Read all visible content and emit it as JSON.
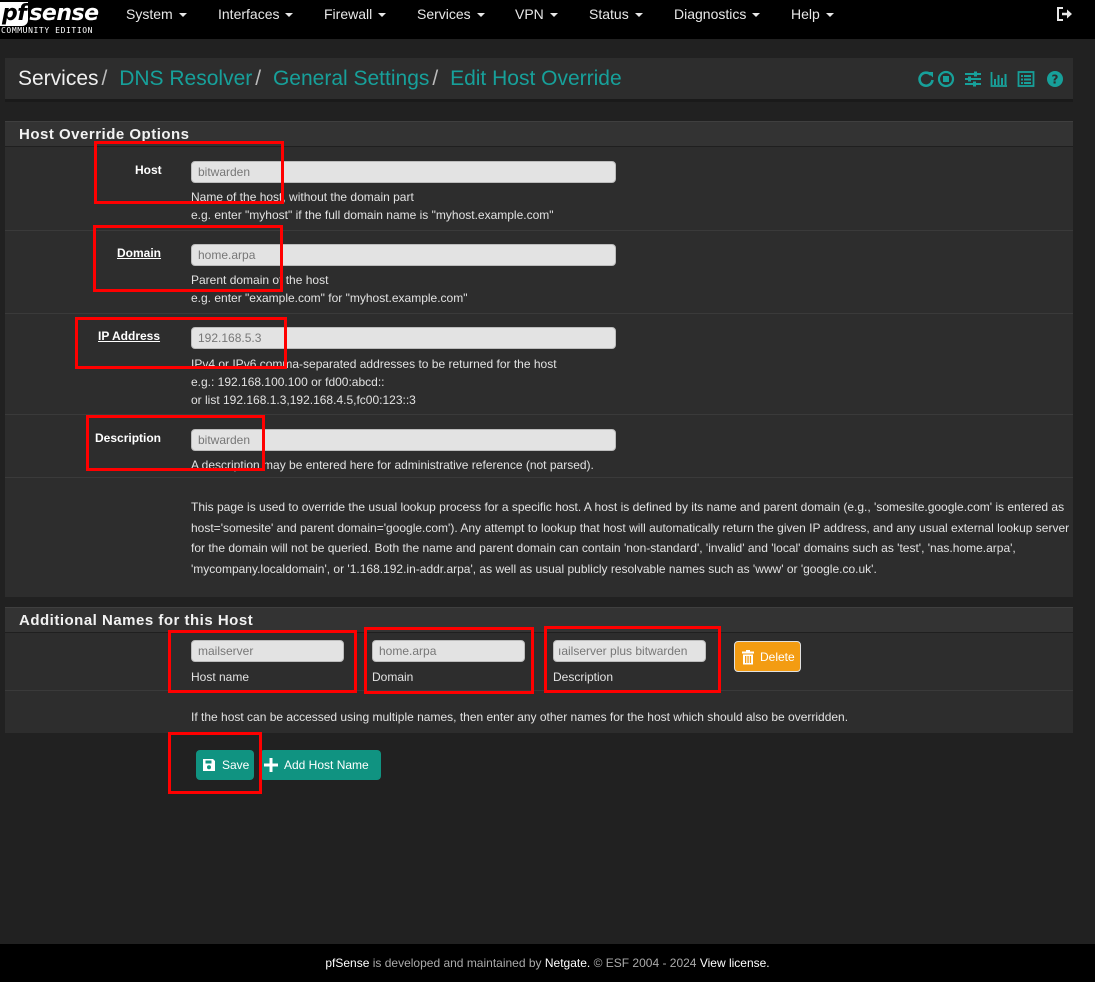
{
  "brand": {
    "logo_prefix": "pf",
    "logo_suffix": "sense",
    "edition": "COMMUNITY EDITION"
  },
  "nav": {
    "items": [
      "System",
      "Interfaces",
      "Firewall",
      "Services",
      "VPN",
      "Status",
      "Diagnostics",
      "Help"
    ]
  },
  "breadcrumb": {
    "items": [
      "Services",
      "DNS Resolver",
      "General Settings",
      "Edit Host Override"
    ],
    "separator": "/"
  },
  "host_override": {
    "title": "Host Override Options",
    "host": {
      "label": "Host",
      "value": "bitwarden",
      "help": [
        "Name of the host, without the domain part",
        "e.g. enter \"myhost\" if the full domain name is \"myhost.example.com\""
      ]
    },
    "domain": {
      "label": "Domain",
      "value": "home.arpa",
      "help": [
        "Parent domain of the host",
        "e.g. enter \"example.com\" for \"myhost.example.com\""
      ]
    },
    "ip": {
      "label": "IP Address",
      "value": "192.168.5.3",
      "help": [
        "IPv4 or IPv6 comma-separated addresses to be returned for the host",
        "e.g.: 192.168.100.100 or fd00:abcd::",
        "or list 192.168.1.3,192.168.4.5,fc00:123::3"
      ]
    },
    "description": {
      "label": "Description",
      "value": "bitwarden",
      "help": "A description may be entered here for administrative reference (not parsed)."
    },
    "info": "This page is used to override the usual lookup process for a specific host. A host is defined by its name and parent domain (e.g., 'somesite.google.com' is entered as host='somesite' and parent domain='google.com'). Any attempt to lookup that host will automatically return the given IP address, and any usual external lookup server for the domain will not be queried. Both the name and parent domain can contain 'non-standard', 'invalid' and 'local' domains such as 'test', 'nas.home.arpa', 'mycompany.localdomain', or '1.168.192.in-addr.arpa', as well as usual publicly resolvable names such as 'www' or 'google.co.uk'."
  },
  "additional": {
    "title": "Additional Names for this Host",
    "host_name": {
      "label": "Host name",
      "value": "mailserver"
    },
    "domain": {
      "label": "Domain",
      "value": "home.arpa"
    },
    "description": {
      "label": "Description",
      "value": "ıailserver plus bitwarden"
    },
    "delete_label": "Delete",
    "help": "If the host can be accessed using multiple names, then enter any other names for the host which should also be overridden."
  },
  "actions": {
    "save_label": "Save",
    "add_label": "Add Host Name"
  },
  "footer": {
    "brand": "pfSense",
    "text1": " is developed and maintained by ",
    "company": "Netgate.",
    "text2": " © ESF 2004 - 2024 ",
    "license": "View license."
  },
  "colors": {
    "accent": "#17a09a",
    "button": "#109381",
    "delete": "#f39c12",
    "highlight": "#ff0000"
  }
}
